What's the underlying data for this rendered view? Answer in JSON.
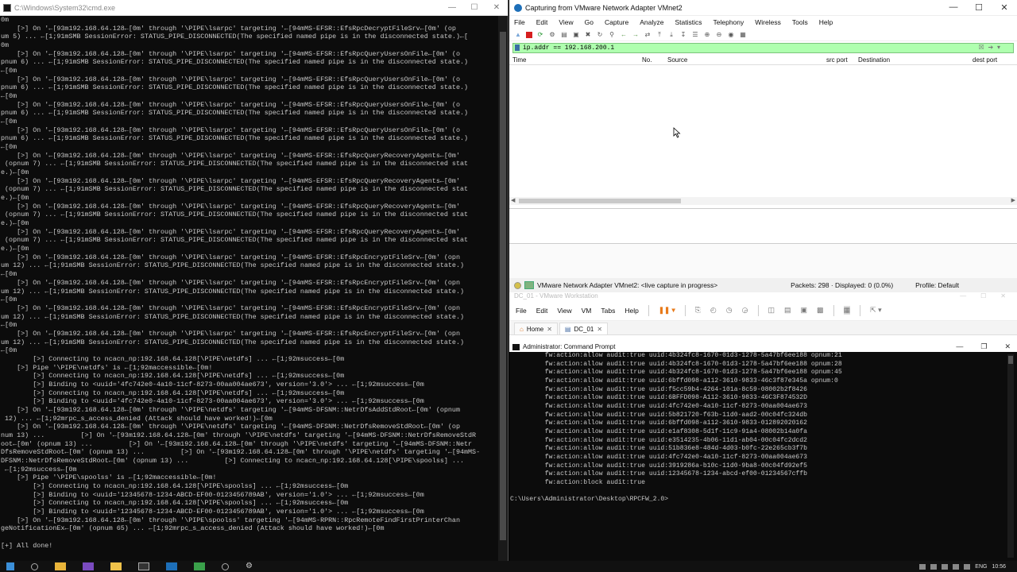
{
  "cmd": {
    "title": "C:\\Windows\\System32\\cmd.exe",
    "lines": [
      "0m",
      "    [>] On '←[93m192.168.64.128←[0m' through '\\PIPE\\lsarpc' targeting '←[94mMS-EFSR::EfsRpcDecryptFileSrv←[0m' (op",
      "um 5) ... ←[1;91mSMB SessionError: STATUS_PIPE_DISCONNECTED(The specified named pipe is in the disconnected state.)←[",
      "0m",
      "    [>] On '←[93m192.168.64.128←[0m' through '\\PIPE\\lsarpc' targeting '←[94mMS-EFSR::EfsRpcQueryUsersOnFile←[0m' (o",
      "pnum 6) ... ←[1;91mSMB SessionError: STATUS_PIPE_DISCONNECTED(The specified named pipe is in the disconnected state.)",
      "←[0m",
      "    [>] On '←[93m192.168.64.128←[0m' through '\\PIPE\\lsarpc' targeting '←[94mMS-EFSR::EfsRpcQueryUsersOnFile←[0m' (o",
      "pnum 6) ... ←[1;91mSMB SessionError: STATUS_PIPE_DISCONNECTED(The specified named pipe is in the disconnected state.)",
      "←[0m",
      "    [>] On '←[93m192.168.64.128←[0m' through '\\PIPE\\lsarpc' targeting '←[94mMS-EFSR::EfsRpcQueryUsersOnFile←[0m' (o",
      "pnum 6) ... ←[1;91mSMB SessionError: STATUS_PIPE_DISCONNECTED(The specified named pipe is in the disconnected state.)",
      "←[0m",
      "    [>] On '←[93m192.168.64.128←[0m' through '\\PIPE\\lsarpc' targeting '←[94mMS-EFSR::EfsRpcQueryUsersOnFile←[0m' (o",
      "pnum 6) ... ←[1;91mSMB SessionError: STATUS_PIPE_DISCONNECTED(The specified named pipe is in the disconnected state.)",
      "←[0m",
      "    [>] On '←[93m192.168.64.128←[0m' through '\\PIPE\\lsarpc' targeting '←[94mMS-EFSR::EfsRpcQueryRecoveryAgents←[0m'",
      " (opnum 7) ... ←[1;91mSMB SessionError: STATUS_PIPE_DISCONNECTED(The specified named pipe is in the disconnected stat",
      "e.)←[0m",
      "    [>] On '←[93m192.168.64.128←[0m' through '\\PIPE\\lsarpc' targeting '←[94mMS-EFSR::EfsRpcQueryRecoveryAgents←[0m'",
      " (opnum 7) ... ←[1;91mSMB SessionError: STATUS_PIPE_DISCONNECTED(The specified named pipe is in the disconnected stat",
      "e.)←[0m",
      "    [>] On '←[93m192.168.64.128←[0m' through '\\PIPE\\lsarpc' targeting '←[94mMS-EFSR::EfsRpcQueryRecoveryAgents←[0m'",
      " (opnum 7) ... ←[1;91mSMB SessionError: STATUS_PIPE_DISCONNECTED(The specified named pipe is in the disconnected stat",
      "e.)←[0m",
      "    [>] On '←[93m192.168.64.128←[0m' through '\\PIPE\\lsarpc' targeting '←[94mMS-EFSR::EfsRpcQueryRecoveryAgents←[0m'",
      " (opnum 7) ... ←[1;91mSMB SessionError: STATUS_PIPE_DISCONNECTED(The specified named pipe is in the disconnected stat",
      "e.)←[0m",
      "    [>] On '←[93m192.168.64.128←[0m' through '\\PIPE\\lsarpc' targeting '←[94mMS-EFSR::EfsRpcEncryptFileSrv←[0m' (opn",
      "um 12) ... ←[1;91mSMB SessionError: STATUS_PIPE_DISCONNECTED(The specified named pipe is in the disconnected state.)",
      "←[0m",
      "    [>] On '←[93m192.168.64.128←[0m' through '\\PIPE\\lsarpc' targeting '←[94mMS-EFSR::EfsRpcEncryptFileSrv←[0m' (opn",
      "um 12) ... ←[1;91mSMB SessionError: STATUS_PIPE_DISCONNECTED(The specified named pipe is in the disconnected state.)",
      "←[0m",
      "    [>] On '←[93m192.168.64.128←[0m' through '\\PIPE\\lsarpc' targeting '←[94mMS-EFSR::EfsRpcEncryptFileSrv←[0m' (opn",
      "um 12) ... ←[1;91mSMB SessionError: STATUS_PIPE_DISCONNECTED(The specified named pipe is in the disconnected state.)",
      "←[0m",
      "    [>] On '←[93m192.168.64.128←[0m' through '\\PIPE\\lsarpc' targeting '←[94mMS-EFSR::EfsRpcEncryptFileSrv←[0m' (opn",
      "um 12) ... ←[1;91mSMB SessionError: STATUS_PIPE_DISCONNECTED(The specified named pipe is in the disconnected state.)",
      "←[0m",
      "        [>] Connecting to ncacn_np:192.168.64.128[\\PIPE\\netdfs] ... ←[1;92msuccess←[0m",
      "    [>] Pipe '\\PIPE\\netdfs' is ←[1;92maccessible←[0m!",
      "        [>] Connecting to ncacn_np:192.168.64.128[\\PIPE\\netdfs] ... ←[1;92msuccess←[0m",
      "        [>] Binding to <uuid='4fc742e0-4a10-11cf-8273-00aa004ae673', version='3.0'> ... ←[1;92msuccess←[0m",
      "        [>] Connecting to ncacn_np:192.168.64.128[\\PIPE\\netdfs] ... ←[1;92msuccess←[0m",
      "        [>] Binding to <uuid='4fc742e0-4a10-11cf-8273-00aa004ae673', version='3.0'> ... ←[1;92msuccess←[0m",
      "    [>] On '←[93m192.168.64.128←[0m' through '\\PIPE\\netdfs' targeting '←[94mMS-DFSNM::NetrDfsAddStdRoot←[0m' (opnum",
      " 12) ... ←[1;92mrpc_s_access_denied (Attack should have worked!)←[0m",
      "    [>] On '←[93m192.168.64.128←[0m' through '\\PIPE\\netdfs' targeting '←[94mMS-DFSNM::NetrDfsRemoveStdRoot←[0m' (op",
      "num 13) ...         [>] On '←[93m192.168.64.128←[0m' through '\\PIPE\\netdfs' targeting '←[94mMS-DFSNM::NetrDfsRemoveStdR",
      "oot←[0m' (opnum 13) ...         [>] On '←[93m192.168.64.128←[0m' through '\\PIPE\\netdfs' targeting '←[94mMS-DFSNM::Netr",
      "DfsRemoveStdRoot←[0m' (opnum 13) ...         [>] On '←[93m192.168.64.128←[0m' through '\\PIPE\\netdfs' targeting '←[94mMS-",
      "DFSNM::NetrDfsRemoveStdRoot←[0m' (opnum 13) ...         [>] Connecting to ncacn_np:192.168.64.128[\\PIPE\\spoolss] ...",
      " ←[1;92msuccess←[0m",
      "    [>] Pipe '\\PIPE\\spoolss' is ←[1;92maccessible←[0m!",
      "        [>] Connecting to ncacn_np:192.168.64.128[\\PIPE\\spoolss] ... ←[1;92msuccess←[0m",
      "        [>] Binding to <uuid='12345678-1234-ABCD-EF00-0123456789AB', version='1.0'> ... ←[1;92msuccess←[0m",
      "        [>] Connecting to ncacn_np:192.168.64.128[\\PIPE\\spoolss] ... ←[1;92msuccess←[0m",
      "        [>] Binding to <uuid='12345678-1234-ABCD-EF00-0123456789AB', version='1.0'> ... ←[1;92msuccess←[0m",
      "    [>] On '←[93m192.168.64.128←[0m' through '\\PIPE\\spoolss' targeting '←[94mMS-RPRN::RpcRemoteFindFirstPrinterChan",
      "geNotificationEx←[0m' (opnum 65) ... ←[1;92mrpc_s_access_denied (Attack should have worked!)←[0m",
      "",
      "[+] All done!"
    ]
  },
  "wireshark": {
    "title": "Capturing from VMware Network Adapter VMnet2",
    "menu": [
      "File",
      "Edit",
      "View",
      "Go",
      "Capture",
      "Analyze",
      "Statistics",
      "Telephony",
      "Wireless",
      "Tools",
      "Help"
    ],
    "filter": "ip.addr == 192.168.200.1",
    "columns": [
      "Time",
      "No.",
      "Source",
      "src port",
      "Destination",
      "dest port"
    ],
    "status_adapter": "VMware Network Adapter VMnet2: <live capture in progress>",
    "status_packets": "Packets: 298 · Displayed: 0 (0.0%)",
    "status_profile": "Profile: Default"
  },
  "vmware": {
    "title": "DC_01 - VMware Workstation",
    "menu": [
      "File",
      "Edit",
      "View",
      "VM",
      "Tabs",
      "Help"
    ],
    "tabs": [
      {
        "label": "Home"
      },
      {
        "label": "DC_01"
      }
    ],
    "guest_title": "Administrator: Command Prompt",
    "guest_lines": [
      "         fw:action:allow audit:true uuid:4b324fc8-1670-01d3-1278-5a47bf6ee188 opnum:21",
      "         fw:action:allow audit:true uuid:4b324fc8-1670-01d3-1278-5a47bf6ee188 opnum:28",
      "         fw:action:allow audit:true uuid:4b324fc8-1670-01d3-1278-5a47bf6ee188 opnum:45",
      "         fw:action:allow audit:true uuid:6bffd098-a112-3610-9833-46c3f87e345a opnum:0",
      "         fw:action:allow audit:true uuid:f5cc59b4-4264-101a-8c59-08002b2f8426",
      "         fw:action:allow audit:true uuid:6BFFD098-A112-3610-9833-46C3F874532D",
      "         fw:action:allow audit:true uuid:4fc742e0-4a10-11cf-8273-00aa004ae673",
      "         fw:action:allow audit:true uuid:5b821720-f63b-11d0-aad2-00c04fc324db",
      "         fw:action:allow audit:true uuid:6bffd098-a112-3610-9833-012892020162",
      "         fw:action:allow audit:true uuid:e1af8308-5d1f-11c9-91a4-08002b14a0fa",
      "         fw:action:allow audit:true uuid:e3514235-4b06-11d1-ab04-00c04fc2dcd2",
      "         fw:action:allow audit:true uuid:51b836e8-484d-4d03-b0fc-22e265cb3f7b",
      "         fw:action:allow audit:true uuid:4fc742e0-4a10-11cf-8273-00aa004ae673",
      "         fw:action:allow audit:true uuid:3919286a-b10c-11d0-9ba8-00c04fd92ef5",
      "         fw:action:allow audit:true uuid:12345678-1234-abcd-ef00-01234567cffb",
      "         fw:action:block audit:true",
      "",
      "C:\\Users\\Administrator\\Desktop\\RPCFW_2.0>"
    ]
  },
  "taskbar": {
    "lang": "ENG",
    "time": "10:56"
  }
}
